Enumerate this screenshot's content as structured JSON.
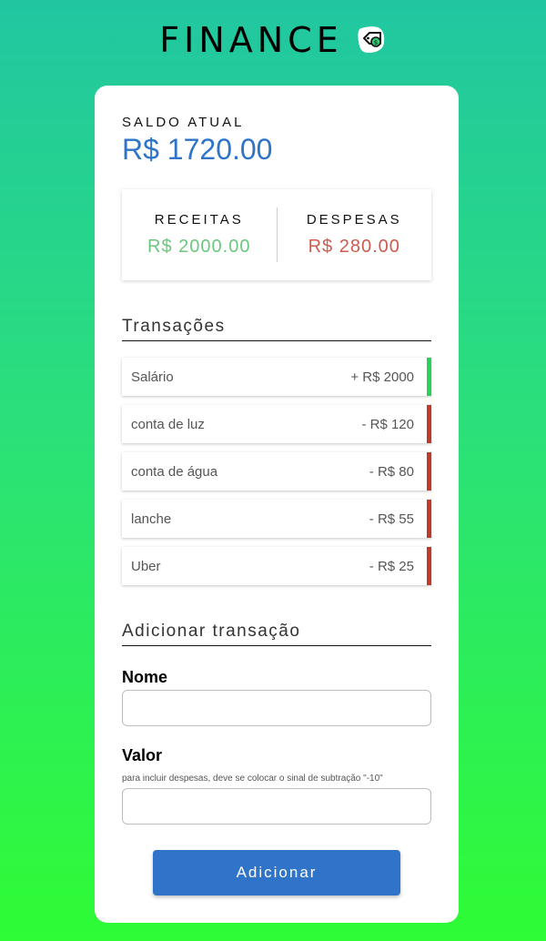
{
  "header": {
    "title": "FINANCE",
    "icon": "money-tag-icon"
  },
  "balance": {
    "label": "SALDO ATUAL",
    "value": "R$ 1720.00"
  },
  "summary": {
    "income_label": "RECEITAS",
    "income_value": "R$ 2000.00",
    "expense_label": "DESPESAS",
    "expense_value": "R$ 280.00"
  },
  "transactions": {
    "title": "Transações",
    "items": [
      {
        "name": "Salário",
        "amount": "+ R$ 2000",
        "type": "income"
      },
      {
        "name": "conta de luz",
        "amount": "- R$ 120",
        "type": "expense"
      },
      {
        "name": "conta de água",
        "amount": "- R$ 80",
        "type": "expense"
      },
      {
        "name": "lanche",
        "amount": "- R$ 55",
        "type": "expense"
      },
      {
        "name": "Uber",
        "amount": "- R$ 25",
        "type": "expense"
      }
    ]
  },
  "form": {
    "title": "Adicionar transação",
    "name_label": "Nome",
    "name_value": "",
    "value_label": "Valor",
    "value_hint": "para incluir despesas, deve se colocar o sinal de subtração \"-10\"",
    "value_value": "",
    "submit_label": "Adicionar"
  },
  "colors": {
    "accent": "#2f74c8",
    "income": "#2ccf5c",
    "expense": "#c0392b"
  }
}
